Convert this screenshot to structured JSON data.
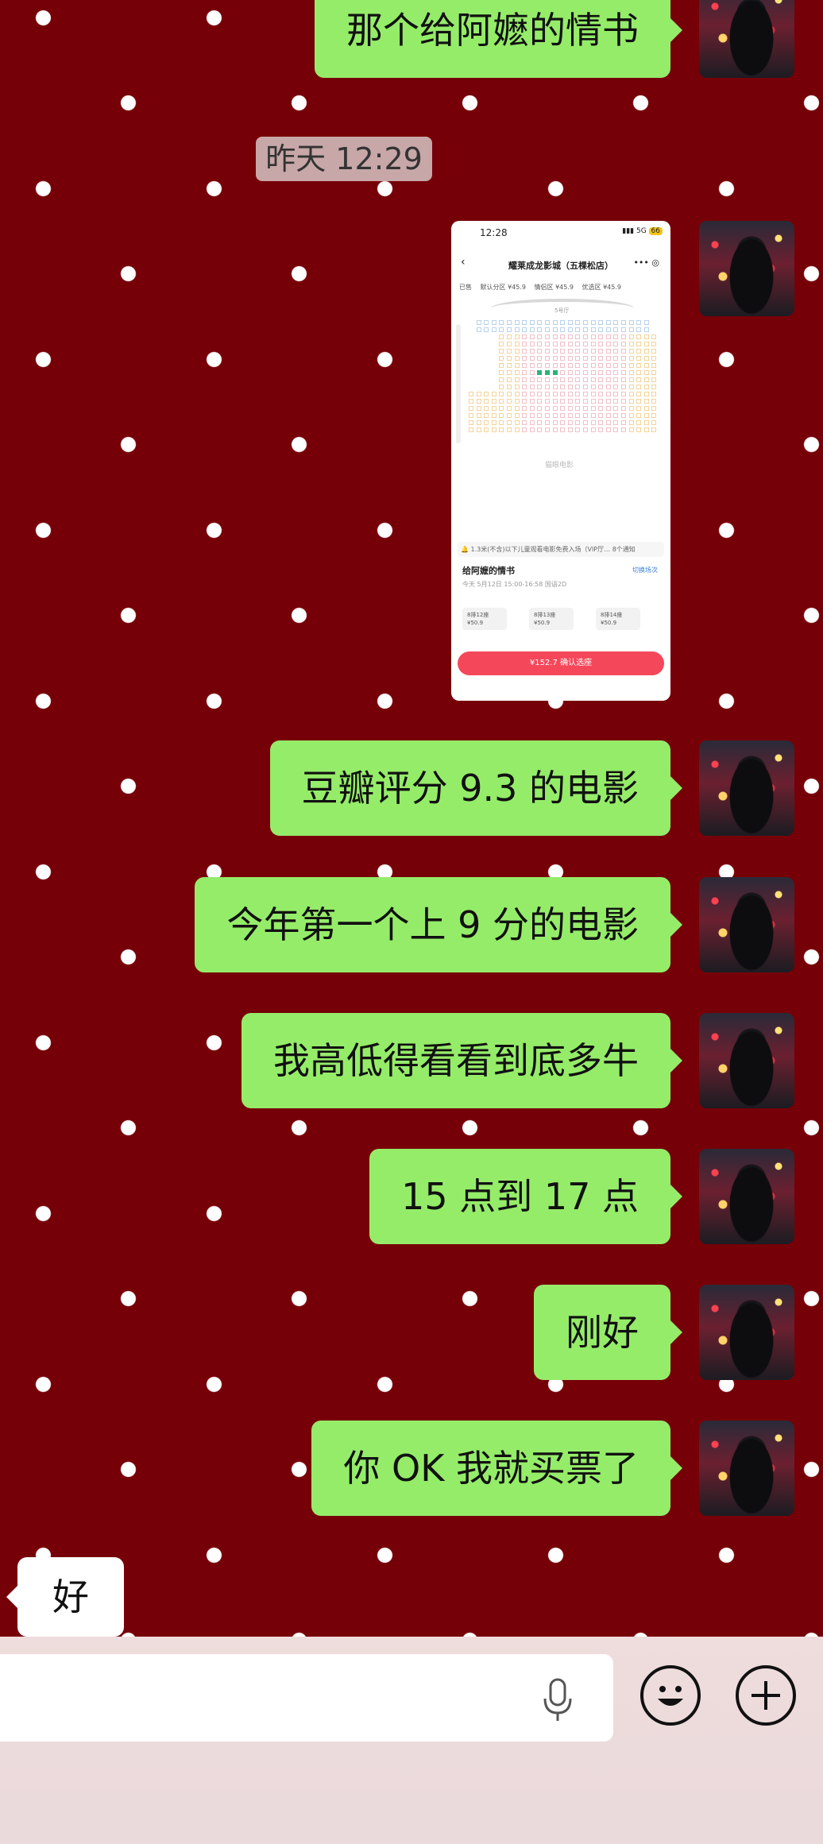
{
  "chat": {
    "timestamp": "昨天 12:29",
    "messages_out": [
      "那个给阿嬷的情书",
      "豆瓣评分 9.3 的电影",
      "今年第一个上 9 分的电影",
      "我高低得看看到底多牛",
      "15 点到 17 点",
      "刚好",
      "你 OK 我就买票了"
    ],
    "message_in": "好",
    "shared_screenshot": {
      "status_time": "12:28",
      "status_right": "5G",
      "battery": "66",
      "cinema": "耀莱成龙影城（五棵松店）",
      "legend": [
        "已售",
        "默认分区 ¥45.9",
        "情侣区 ¥45.9",
        "优选区 ¥45.9"
      ],
      "hall": "5号厅",
      "logo": "猫眼电影",
      "notice": "1.3米(不含)以下儿童观看电影免费入场（VIP厅…",
      "notice_right": "8个通知",
      "movie": "给阿嬷的情书",
      "change": "切换场次",
      "showtime": "今天 5月12日 15:00-16:58 国语2D",
      "seats": [
        {
          "seat": "8排12座",
          "price": "¥50.9"
        },
        {
          "seat": "8排13座",
          "price": "¥50.9"
        },
        {
          "seat": "8排14座",
          "price": "¥50.9"
        }
      ],
      "confirm": "¥152.7 确认选座"
    }
  },
  "input_bar": {
    "mic_icon": "microphone-icon",
    "emoji_icon": "emoji-icon",
    "plus_icon": "plus-circle-icon"
  }
}
